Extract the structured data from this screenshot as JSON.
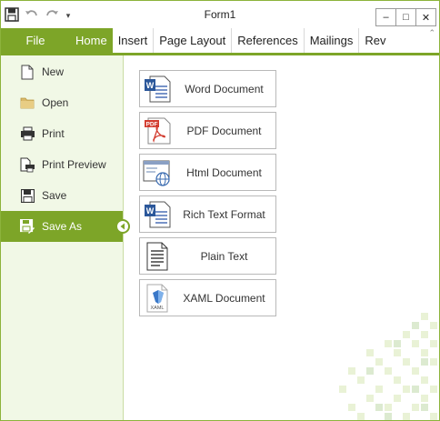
{
  "window": {
    "title": "Form1"
  },
  "quick_access": {
    "icons": [
      "save-icon",
      "undo-icon",
      "redo-icon"
    ],
    "dropdown": "▾"
  },
  "window_controls": {
    "minimize": "–",
    "maximize": "□",
    "close": "✕"
  },
  "ribbon": {
    "file_tab": "File",
    "tabs": [
      {
        "label": "Home",
        "selected": true
      },
      {
        "label": "Insert",
        "selected": false
      },
      {
        "label": "Page Layout",
        "selected": false
      },
      {
        "label": "References",
        "selected": false
      },
      {
        "label": "Mailings",
        "selected": false
      },
      {
        "label": "Rev",
        "selected": false
      }
    ],
    "collapse_glyph": "⌃"
  },
  "menu": {
    "items": [
      {
        "label": "New",
        "icon": "new-document-icon"
      },
      {
        "label": "Open",
        "icon": "folder-icon"
      },
      {
        "label": "Print",
        "icon": "printer-icon"
      },
      {
        "label": "Print Preview",
        "icon": "print-preview-icon"
      },
      {
        "label": "Save",
        "icon": "save-icon"
      },
      {
        "label": "Save As",
        "icon": "save-as-icon",
        "selected": true
      }
    ]
  },
  "save_as": {
    "formats": [
      {
        "label": "Word Document",
        "icon": "word-document-icon"
      },
      {
        "label": "PDF Document",
        "icon": "pdf-document-icon"
      },
      {
        "label": "Html Document",
        "icon": "html-document-icon"
      },
      {
        "label": "Rich Text Format",
        "icon": "rtf-document-icon"
      },
      {
        "label": "Plain Text",
        "icon": "plain-text-icon"
      },
      {
        "label": "XAML Document",
        "icon": "xaml-document-icon"
      }
    ],
    "xaml_icon_text": "XAML",
    "pdf_icon_text": "PDF"
  },
  "colors": {
    "accent": "#7da528",
    "menu_bg": "#f1f8e6",
    "border": "#8cb33b"
  }
}
